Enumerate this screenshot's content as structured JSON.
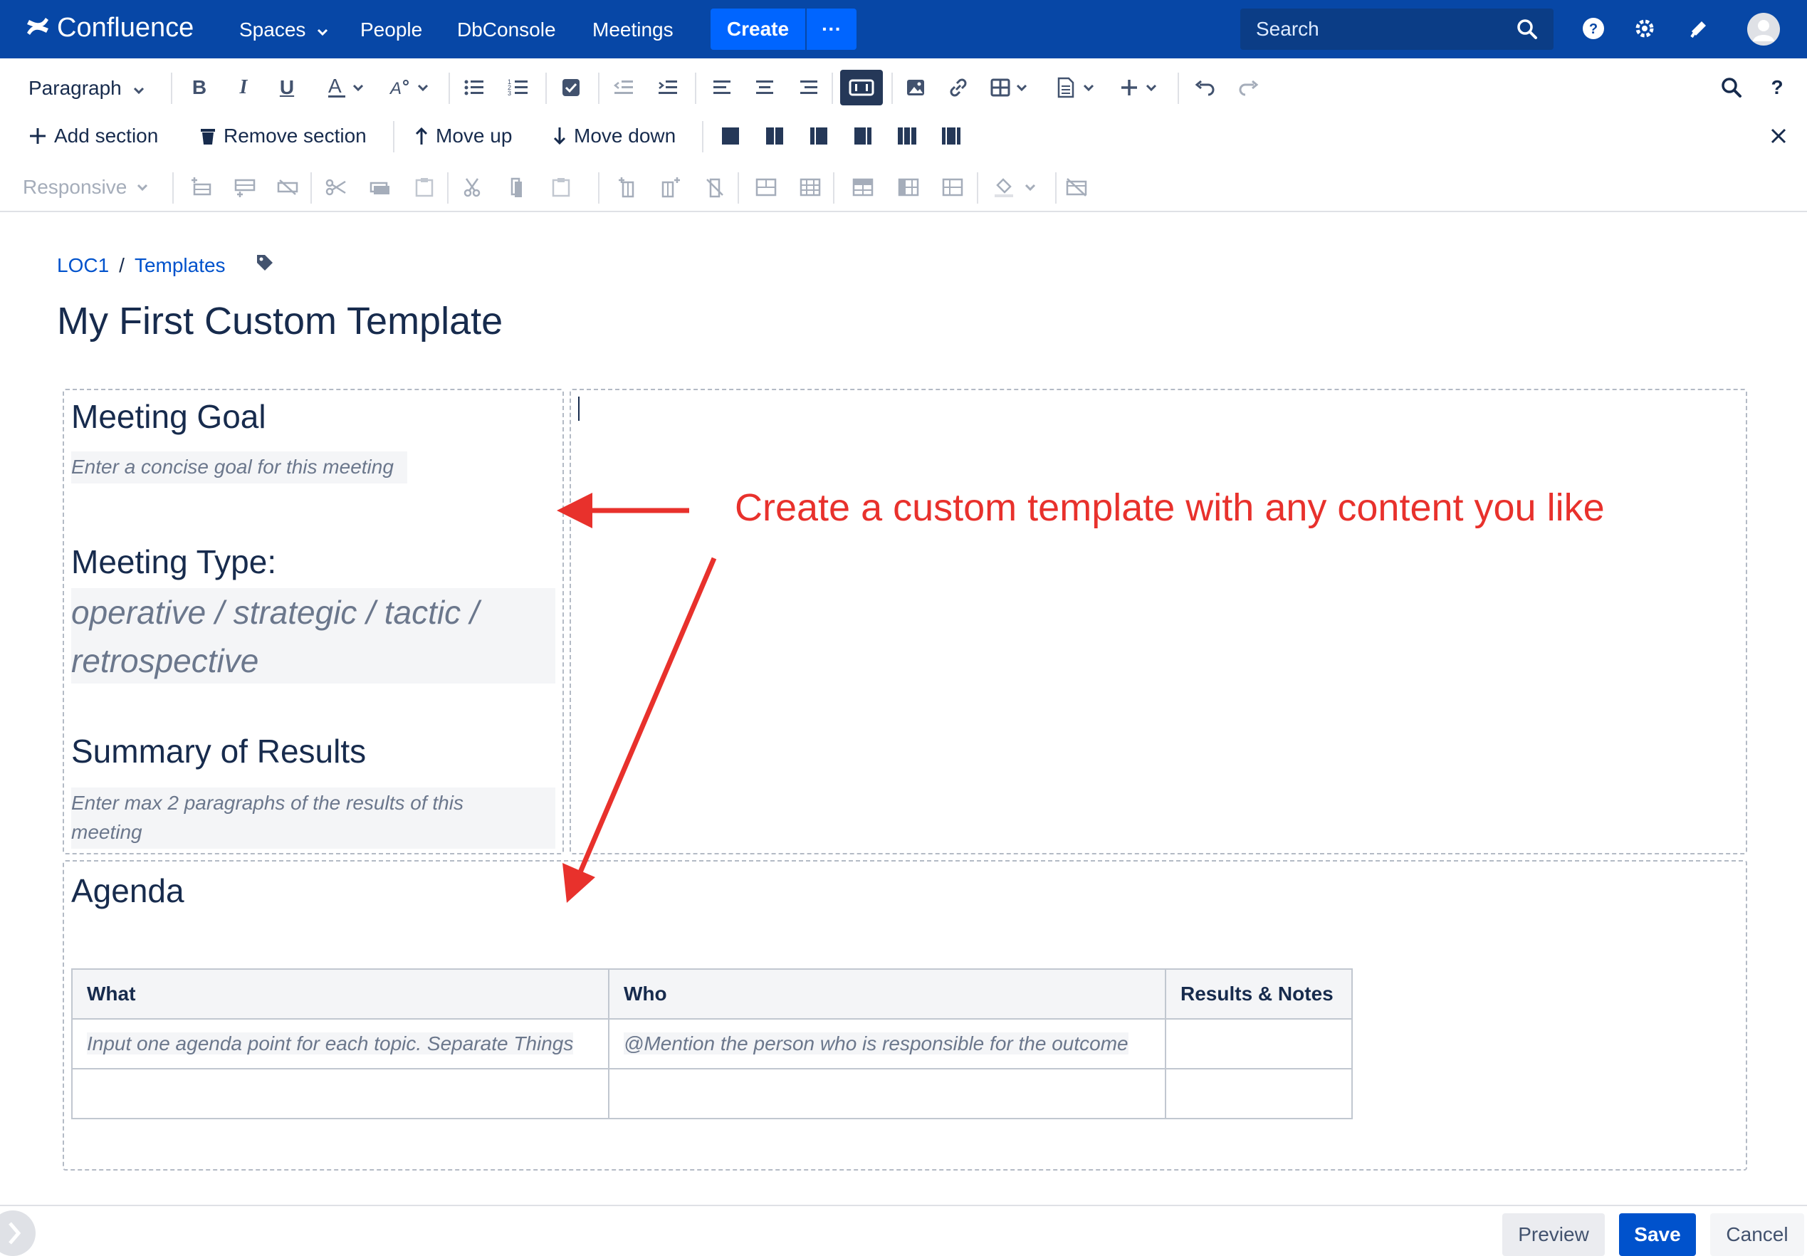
{
  "app": {
    "name": "Confluence"
  },
  "topnav": {
    "spaces": "Spaces",
    "people": "People",
    "dbconsole": "DbConsole",
    "meetings": "Meetings",
    "create": "Create",
    "more": "···",
    "search_placeholder": "Search"
  },
  "toolbar": {
    "paragraph": "Paragraph",
    "responsive": "Responsive",
    "add_section": "Add section",
    "remove_section": "Remove section",
    "move_up": "Move up",
    "move_down": "Move down"
  },
  "breadcrumb": {
    "space": "LOC1",
    "separator": "/",
    "parent": "Templates"
  },
  "page": {
    "title": "My First Custom Template"
  },
  "left_section": {
    "goal_heading": "Meeting Goal",
    "goal_placeholder": "Enter a concise goal for this meeting",
    "type_heading": "Meeting Type:",
    "type_placeholder_line1": "operative / strategic / tactic /",
    "type_placeholder_line2": "retrospective",
    "summary_heading": "Summary of Results",
    "summary_placeholder_line1": "Enter max 2 paragraphs of the results of this",
    "summary_placeholder_line2": "meeting"
  },
  "agenda": {
    "heading": "Agenda",
    "columns": [
      "What",
      "Who",
      "Results & Notes"
    ],
    "rows": [
      [
        "Input one agenda point for each topic. Separate Things",
        "@Mention the person who is responsible for the outcome",
        ""
      ],
      [
        "",
        "",
        ""
      ]
    ]
  },
  "annotation": {
    "text": "Create a custom template with any content you like",
    "color": "#e8312c"
  },
  "footer": {
    "preview": "Preview",
    "save": "Save",
    "cancel": "Cancel"
  },
  "colors": {
    "nav_bg": "#0747a6",
    "primary": "#0052cc",
    "create_bg": "#0065ff"
  }
}
